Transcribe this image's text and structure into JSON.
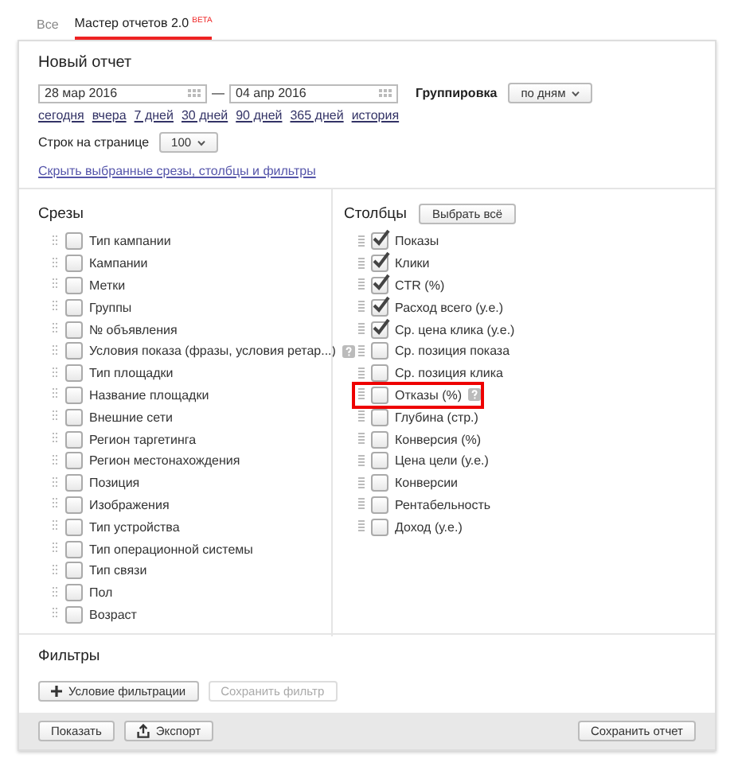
{
  "tabs": [
    {
      "label": "Все",
      "selected": false
    },
    {
      "label": "Мастер отчетов 2.0",
      "badge": "BETA",
      "selected": true
    }
  ],
  "report": {
    "title": "Новый отчет",
    "date_from": "28 мар 2016",
    "date_separator": "—",
    "date_to": "04 апр 2016",
    "grouping_label": "Группировка",
    "grouping_value": "по дням",
    "quick_periods": [
      "сегодня",
      "вчера",
      "7 дней",
      "30 дней",
      "90 дней",
      "365 дней",
      "история"
    ],
    "rows_label": "Строк на странице",
    "rows_value": "100",
    "hide_link": "Скрыть выбранные срезы, столбцы и фильтры"
  },
  "slices": {
    "title": "Срезы",
    "items": [
      {
        "label": "Тип кампании",
        "checked": false,
        "help": false
      },
      {
        "label": "Кампании",
        "checked": false,
        "help": false
      },
      {
        "label": "Метки",
        "checked": false,
        "help": false
      },
      {
        "label": "Группы",
        "checked": false,
        "help": false
      },
      {
        "label": "№ объявления",
        "checked": false,
        "help": false
      },
      {
        "label": "Условия показа (фразы, условия ретар...)",
        "checked": false,
        "help": true
      },
      {
        "label": "Тип площадки",
        "checked": false,
        "help": false
      },
      {
        "label": "Название площадки",
        "checked": false,
        "help": false
      },
      {
        "label": "Внешние сети",
        "checked": false,
        "help": false
      },
      {
        "label": "Регион таргетинга",
        "checked": false,
        "help": false
      },
      {
        "label": "Регион местонахождения",
        "checked": false,
        "help": false
      },
      {
        "label": "Позиция",
        "checked": false,
        "help": false
      },
      {
        "label": "Изображения",
        "checked": false,
        "help": false
      },
      {
        "label": "Тип устройства",
        "checked": false,
        "help": false
      },
      {
        "label": "Тип операционной системы",
        "checked": false,
        "help": false
      },
      {
        "label": "Тип связи",
        "checked": false,
        "help": false
      },
      {
        "label": "Пол",
        "checked": false,
        "help": false
      },
      {
        "label": "Возраст",
        "checked": false,
        "help": false
      }
    ]
  },
  "columns": {
    "title": "Столбцы",
    "select_all": "Выбрать всё",
    "items": [
      {
        "label": "Показы",
        "checked": true,
        "help": false,
        "highlighted": false
      },
      {
        "label": "Клики",
        "checked": true,
        "help": false,
        "highlighted": false
      },
      {
        "label": "CTR (%)",
        "checked": true,
        "help": false,
        "highlighted": false
      },
      {
        "label": "Расход всего (у.е.)",
        "checked": true,
        "help": false,
        "highlighted": false
      },
      {
        "label": "Ср. цена клика (у.е.)",
        "checked": true,
        "help": false,
        "highlighted": false
      },
      {
        "label": "Ср. позиция показа",
        "checked": false,
        "help": false,
        "highlighted": false
      },
      {
        "label": "Ср. позиция клика",
        "checked": false,
        "help": false,
        "highlighted": false
      },
      {
        "label": "Отказы (%)",
        "checked": false,
        "help": true,
        "highlighted": true
      },
      {
        "label": "Глубина (стр.)",
        "checked": false,
        "help": false,
        "highlighted": false
      },
      {
        "label": "Конверсия (%)",
        "checked": false,
        "help": false,
        "highlighted": false
      },
      {
        "label": "Цена цели (у.е.)",
        "checked": false,
        "help": false,
        "highlighted": false
      },
      {
        "label": "Конверсии",
        "checked": false,
        "help": false,
        "highlighted": false
      },
      {
        "label": "Рентабельность",
        "checked": false,
        "help": false,
        "highlighted": false
      },
      {
        "label": "Доход (у.е.)",
        "checked": false,
        "help": false,
        "highlighted": false
      }
    ]
  },
  "filters": {
    "title": "Фильтры",
    "add_button": "Условие фильтрации",
    "save_button": {
      "label": "Сохранить фильтр",
      "disabled": true
    }
  },
  "footer": {
    "show_button": "Показать",
    "export_button": "Экспорт",
    "save_report_button": "Сохранить отчет"
  }
}
